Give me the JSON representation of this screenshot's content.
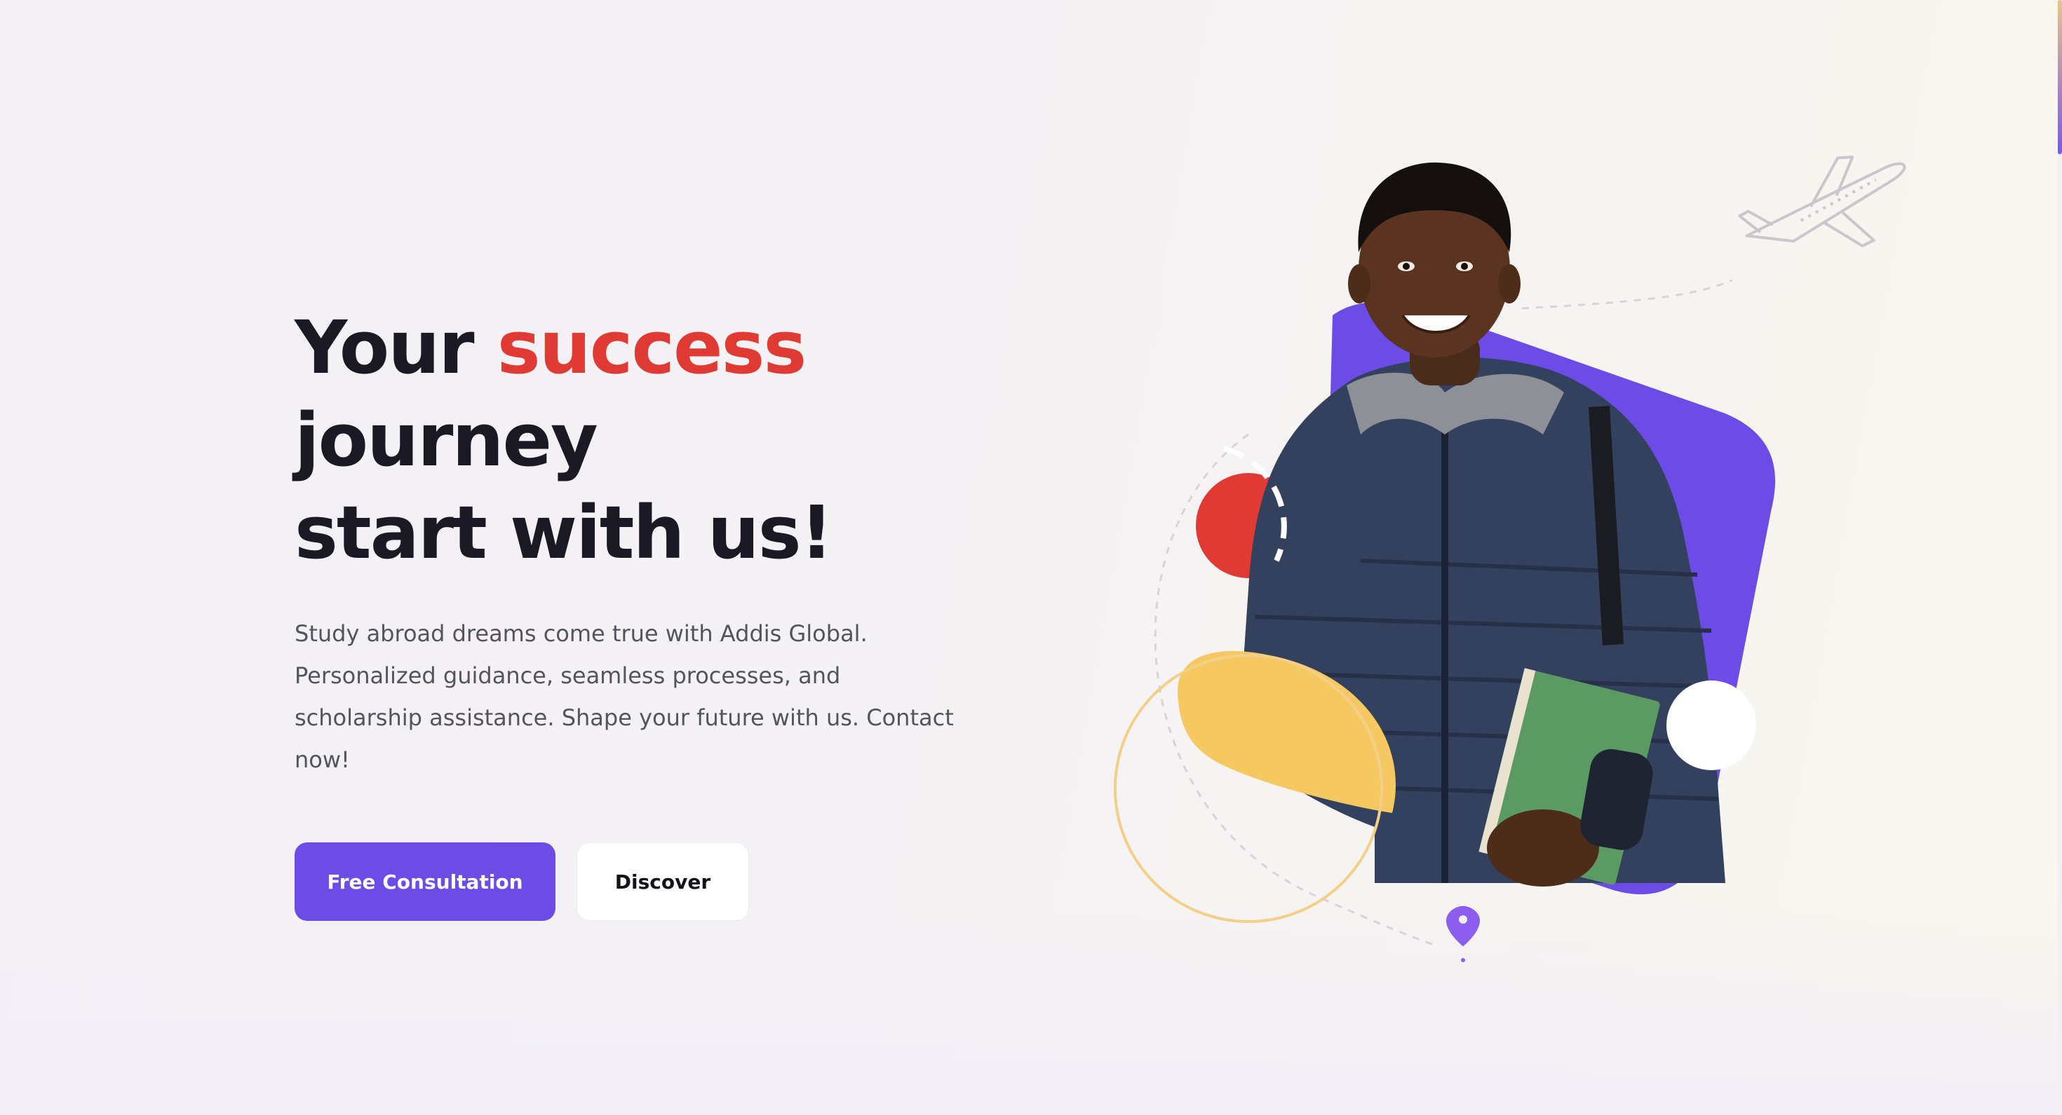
{
  "hero": {
    "headline_part1": "Your ",
    "headline_accent": "success",
    "headline_part2": " journey",
    "headline_line2": "start with us!",
    "description": "Study abroad dreams come true with Addis Global. Personalized guidance, seamless processes, and scholarship assistance. Shape your future with us. Contact now!",
    "primary_cta": "Free Consultation",
    "secondary_cta": "Discover"
  },
  "colors": {
    "accent_red": "#e03a34",
    "brand_purple": "#6c4be6",
    "highlight_yellow": "#f6c862",
    "heading": "#1b1a24",
    "body_text": "#55535d"
  },
  "icons": {
    "airplane": "airplane-icon",
    "location_pin": "location-pin-icon"
  }
}
